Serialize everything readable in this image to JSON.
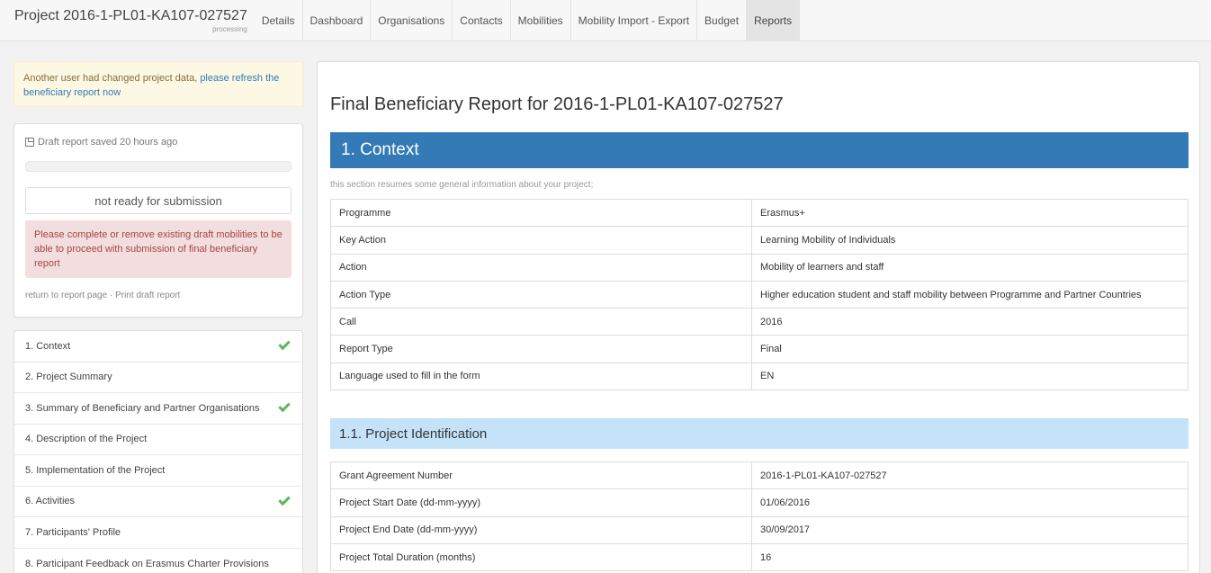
{
  "app": {
    "project_title": "Project 2016-1-PL01-KA107-027527",
    "project_status": "processing"
  },
  "nav": {
    "tabs": [
      {
        "label": "Details"
      },
      {
        "label": "Dashboard"
      },
      {
        "label": "Organisations"
      },
      {
        "label": "Contacts"
      },
      {
        "label": "Mobilities"
      },
      {
        "label": "Mobility Import - Export"
      },
      {
        "label": "Budget"
      },
      {
        "label": "Reports",
        "active": true
      }
    ]
  },
  "sidebar": {
    "warning_text": "Another user had changed project data, ",
    "warning_link": "please refresh the beneficiary report now",
    "draft_status": "Draft report saved 20 hours ago",
    "progress_percent": 0,
    "submit_label": "not ready for submission",
    "error_text": "Please complete or remove existing draft mobilities to be able to proceed with submission of final beneficiary report",
    "return_link": "return to report page",
    "link_separator": "·",
    "print_link": "Print draft report",
    "sections": [
      {
        "label": "1. Context",
        "complete": true
      },
      {
        "label": "2. Project Summary",
        "complete": false
      },
      {
        "label": "3. Summary of Beneficiary and Partner Organisations",
        "complete": true
      },
      {
        "label": "4. Description of the Project",
        "complete": false
      },
      {
        "label": "5. Implementation of the Project",
        "complete": false
      },
      {
        "label": "6. Activities",
        "complete": true
      },
      {
        "label": "7. Participants' Profile",
        "complete": false
      },
      {
        "label": "8. Participant Feedback on Erasmus Charter Provisions",
        "complete": false
      }
    ]
  },
  "main": {
    "report_title": "Final Beneficiary Report for 2016-1-PL01-KA107-027527",
    "context": {
      "header": "1. Context",
      "description": "this section resumes some general information about your project;",
      "rows": [
        {
          "key": "Programme",
          "value": "Erasmus+"
        },
        {
          "key": "Key Action",
          "value": "Learning Mobility of Individuals"
        },
        {
          "key": "Action",
          "value": "Mobility of learners and staff"
        },
        {
          "key": "Action Type",
          "value": "Higher education student and staff mobility between Programme and Partner Countries"
        },
        {
          "key": "Call",
          "value": "2016"
        },
        {
          "key": "Report Type",
          "value": "Final"
        },
        {
          "key": "Language used to fill in the form",
          "value": "EN"
        }
      ]
    },
    "identification": {
      "header": "1.1. Project Identification",
      "rows": [
        {
          "key": "Grant Agreement Number",
          "value": "2016-1-PL01-KA107-027527"
        },
        {
          "key": "Project Start Date (dd-mm-yyyy)",
          "value": "01/06/2016"
        },
        {
          "key": "Project End Date (dd-mm-yyyy)",
          "value": "30/09/2017"
        },
        {
          "key": "Project Total Duration (months)",
          "value": "16"
        }
      ]
    }
  },
  "colors": {
    "section_header": "#337ab7",
    "subsection_header": "#c4e3f9",
    "check": "#5cb85c",
    "warning_bg": "#fcf8e3",
    "danger_bg": "#f2dede"
  }
}
